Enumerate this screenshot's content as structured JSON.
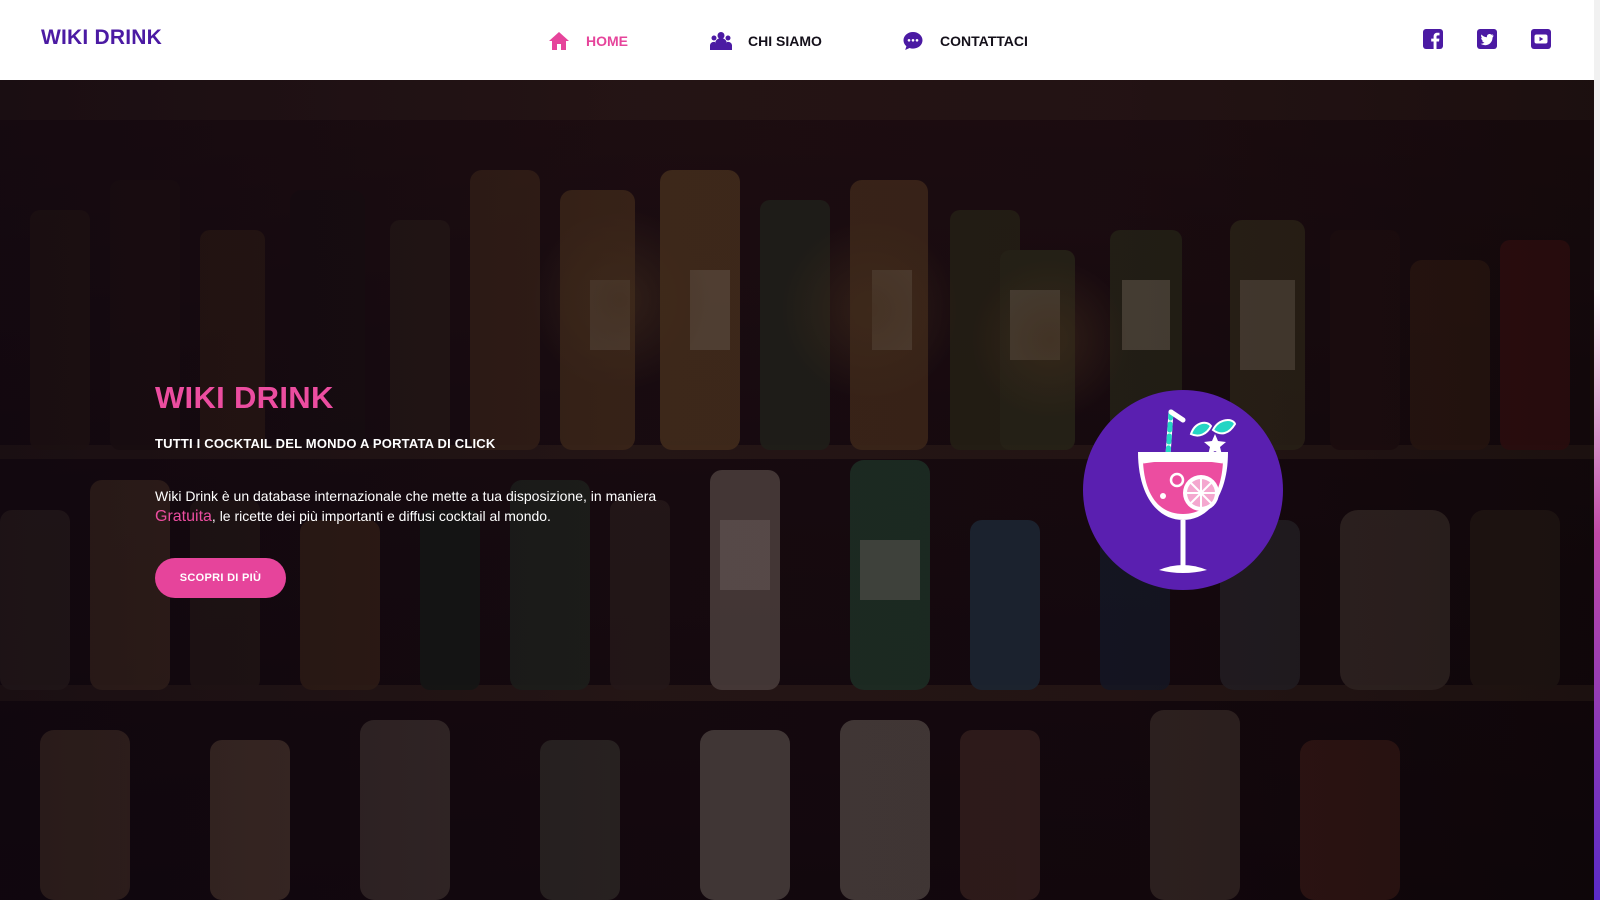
{
  "header": {
    "brand": "WIKI DRINK",
    "nav": [
      {
        "label": "HOME",
        "icon": "home-icon",
        "active": true
      },
      {
        "label": "CHI SIAMO",
        "icon": "users-icon",
        "active": false
      },
      {
        "label": "CONTATTACI",
        "icon": "chat-icon",
        "active": false
      }
    ],
    "social": [
      "facebook-icon",
      "twitter-icon",
      "youtube-icon"
    ]
  },
  "hero": {
    "title": "WIKI DRINK",
    "subtitle": "TUTTI I COCKTAIL DEL MONDO A PORTATA DI CLICK",
    "desc_part1": "Wiki Drink è un database internazionale che mette a tua disposizione, in maniera ",
    "desc_highlight": "Gratuita",
    "desc_part2": ", le ricette dei più importanti e diffusi cocktail al mondo.",
    "cta_label": "SCOPRI DI PIÙ",
    "logo_icon": "cocktail-glass-icon"
  },
  "colors": {
    "brand_purple": "#4b1aa3",
    "accent_pink": "#e6449b",
    "circle_purple": "#5a1fb0"
  }
}
